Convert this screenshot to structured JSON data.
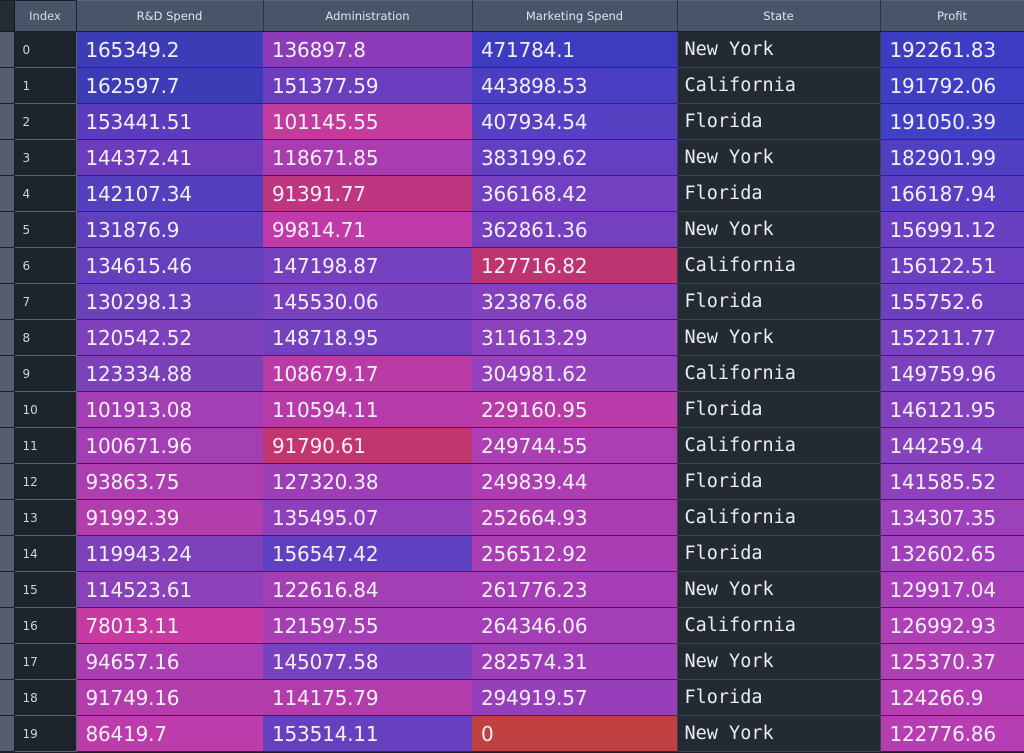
{
  "table": {
    "index_header": "Index",
    "columns": [
      {
        "key": "rd",
        "label": "R&D Spend"
      },
      {
        "key": "admin",
        "label": "Administration"
      },
      {
        "key": "mkt",
        "label": "Marketing Spend"
      },
      {
        "key": "state",
        "label": "State"
      },
      {
        "key": "profit",
        "label": "Profit"
      }
    ],
    "rows": [
      {
        "index": "0",
        "rd": "165349.2",
        "rd_c": "#3b3cb6",
        "admin": "136897.8",
        "admin_c": "#8c3cb8",
        "mkt": "471784.1",
        "mkt_c": "#3c3cc0",
        "state": "New York",
        "profit": "192261.83",
        "profit_c": "#3d3dc3"
      },
      {
        "index": "1",
        "rd": "162597.7",
        "rd_c": "#3c3cb6",
        "admin": "151377.59",
        "admin_c": "#6b3ec0",
        "mkt": "443898.53",
        "mkt_c": "#4a3fc2",
        "state": "California",
        "profit": "191792.06",
        "profit_c": "#3f3ec4"
      },
      {
        "index": "2",
        "rd": "153441.51",
        "rd_c": "#5a3cbc",
        "admin": "101145.55",
        "admin_c": "#c33b9c",
        "mkt": "407934.54",
        "mkt_c": "#5740c2",
        "state": "Florida",
        "profit": "191050.39",
        "profit_c": "#413fc4"
      },
      {
        "index": "3",
        "rd": "144372.41",
        "rd_c": "#6d3cbd",
        "admin": "118671.85",
        "admin_c": "#a93cae",
        "mkt": "383199.62",
        "mkt_c": "#6340c2",
        "state": "New York",
        "profit": "182901.99",
        "profit_c": "#4f3fc3"
      },
      {
        "index": "4",
        "rd": "142107.34",
        "rd_c": "#5340bd",
        "admin": "91391.77",
        "admin_c": "#be3580",
        "mkt": "366168.42",
        "mkt_c": "#7240c0",
        "state": "Florida",
        "profit": "166187.94",
        "profit_c": "#5b3fc2"
      },
      {
        "index": "5",
        "rd": "131876.9",
        "rd_c": "#6140bd",
        "admin": "99814.71",
        "admin_c": "#c03aaa",
        "mkt": "362861.36",
        "mkt_c": "#7440c0",
        "state": "New York",
        "profit": "156991.12",
        "profit_c": "#6a40c0"
      },
      {
        "index": "6",
        "rd": "134615.46",
        "rd_c": "#6540bd",
        "admin": "147198.87",
        "admin_c": "#7540bf",
        "mkt": "127716.82",
        "mkt_c": "#bc3570",
        "state": "California",
        "profit": "156122.51",
        "profit_c": "#6c40c0"
      },
      {
        "index": "7",
        "rd": "130298.13",
        "rd_c": "#6b41bc",
        "admin": "145530.06",
        "admin_c": "#7a41be",
        "mkt": "323876.68",
        "mkt_c": "#8540bd",
        "state": "Florida",
        "profit": "155752.6",
        "profit_c": "#6e40c0"
      },
      {
        "index": "8",
        "rd": "120542.52",
        "rd_c": "#7f41bb",
        "admin": "148718.95",
        "admin_c": "#7441bf",
        "mkt": "311613.29",
        "mkt_c": "#8d41bd",
        "state": "New York",
        "profit": "152211.77",
        "profit_c": "#7640bf"
      },
      {
        "index": "9",
        "rd": "123334.88",
        "rd_c": "#7a41bb",
        "admin": "108679.17",
        "admin_c": "#ba3ba6",
        "mkt": "304981.62",
        "mkt_c": "#9341bc",
        "state": "California",
        "profit": "149759.96",
        "profit_c": "#7b41bf"
      },
      {
        "index": "10",
        "rd": "101913.08",
        "rd_c": "#a33eb4",
        "admin": "110594.11",
        "admin_c": "#b63ba8",
        "mkt": "229160.95",
        "mkt_c": "#b93ba9",
        "state": "Florida",
        "profit": "146121.95",
        "profit_c": "#8341be"
      },
      {
        "index": "11",
        "rd": "100671.96",
        "rd_c": "#a43fb3",
        "admin": "91790.61",
        "admin_c": "#c2356f",
        "mkt": "249744.55",
        "mkt_c": "#ad3db2",
        "state": "California",
        "profit": "144259.4",
        "profit_c": "#8741be"
      },
      {
        "index": "12",
        "rd": "93863.75",
        "rd_c": "#ac3eb0",
        "admin": "127320.38",
        "admin_c": "#9d3eb7",
        "mkt": "249839.44",
        "mkt_c": "#ad3db2",
        "state": "Florida",
        "profit": "141585.52",
        "profit_c": "#8e41bd"
      },
      {
        "index": "13",
        "rd": "91992.39",
        "rd_c": "#b23eae",
        "admin": "135495.07",
        "admin_c": "#8f3fba",
        "mkt": "252664.93",
        "mkt_c": "#ab3db3",
        "state": "California",
        "profit": "134307.35",
        "profit_c": "#9c41bb"
      },
      {
        "index": "14",
        "rd": "119943.24",
        "rd_c": "#7f41bb",
        "admin": "156547.42",
        "admin_c": "#5e40c1",
        "mkt": "256512.92",
        "mkt_c": "#a83db4",
        "state": "Florida",
        "profit": "132602.65",
        "profit_c": "#a040ba"
      },
      {
        "index": "15",
        "rd": "114523.61",
        "rd_c": "#8a41b9",
        "admin": "122616.84",
        "admin_c": "#a43eb4",
        "mkt": "261776.23",
        "mkt_c": "#a53db6",
        "state": "New York",
        "profit": "129917.04",
        "profit_c": "#a740b8"
      },
      {
        "index": "16",
        "rd": "78013.11",
        "rd_c": "#c63aa2",
        "admin": "121597.55",
        "admin_c": "#a63eb5",
        "mkt": "264346.06",
        "mkt_c": "#a33eb6",
        "state": "California",
        "profit": "126992.93",
        "profit_c": "#ae3fb6"
      },
      {
        "index": "17",
        "rd": "94657.16",
        "rd_c": "#ab3eb0",
        "admin": "145077.58",
        "admin_c": "#7a41be",
        "mkt": "282574.31",
        "mkt_c": "#9d3eb8",
        "state": "New York",
        "profit": "125370.37",
        "profit_c": "#b13fb4"
      },
      {
        "index": "18",
        "rd": "91749.16",
        "rd_c": "#b23eae",
        "admin": "114175.79",
        "admin_c": "#b23cac",
        "mkt": "294919.57",
        "mkt_c": "#973ebb",
        "state": "Florida",
        "profit": "124266.9",
        "profit_c": "#b43eb3"
      },
      {
        "index": "19",
        "rd": "86419.7",
        "rd_c": "#bb3caa",
        "admin": "153514.11",
        "admin_c": "#6740c0",
        "mkt": "0",
        "mkt_c": "#c0413f",
        "state": "New York",
        "profit": "122776.86",
        "profit_c": "#b73eb2"
      }
    ]
  },
  "theme": {
    "background": "#1b2028",
    "header_bg": "#4a5468",
    "header_fg": "#dfe4ec",
    "index_bg": "#1e242c",
    "index_fg": "#cfd5e0",
    "state_bg": "#242a33",
    "cell_fg": "#f2f0f6",
    "selector_bg": "#555e6e",
    "gradient_low": "#3b3cb6",
    "gradient_high": "#c63aa2",
    "zero_highlight": "#c0413f"
  }
}
